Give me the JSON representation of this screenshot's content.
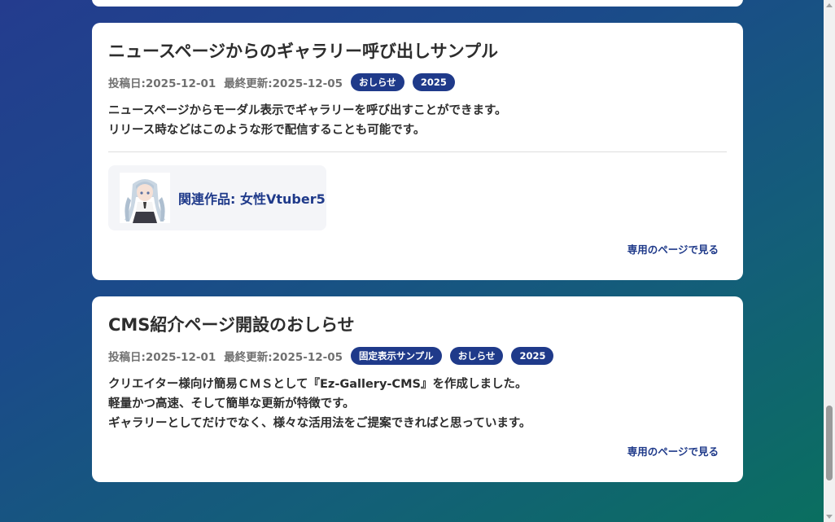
{
  "posts": [
    {
      "title": "ニュースページからのギャラリー呼び出しサンプル",
      "posted": "投稿日:2025-12-01",
      "updated": "最終更新:2025-12-05",
      "tags": [
        "おしらせ",
        "2025"
      ],
      "body_lines": [
        "ニュースページからモーダル表示でギャラリーを呼び出すことができます。",
        "リリース時などはこのような形で配信することも可能です。"
      ],
      "related": {
        "label": "関連作品: 女性Vtuber5",
        "thumbnail_icon": "vtuber-character-thumbnail"
      },
      "more_link": "専用のページで見る"
    },
    {
      "title": "CMS紹介ページ開設のおしらせ",
      "posted": "投稿日:2025-12-01",
      "updated": "最終更新:2025-12-05",
      "tags": [
        "固定表示サンプル",
        "おしらせ",
        "2025"
      ],
      "body_lines": [
        "クリエイター様向け簡易ＣＭＳとして『Ez-Gallery-CMS』を作成しました。",
        "軽量かつ高速、そして簡単な更新が特徴です。",
        "ギャラリーとしてだけでなく、様々な活用法をご提案できればと思っています。"
      ],
      "more_link": "専用のページで見る"
    }
  ],
  "colors": {
    "accent": "#1f3a8a",
    "tag_bg": "#1f3a8a",
    "background_start": "#243c8e",
    "background_end": "#0a6f5f",
    "card_bg": "#ffffff"
  }
}
